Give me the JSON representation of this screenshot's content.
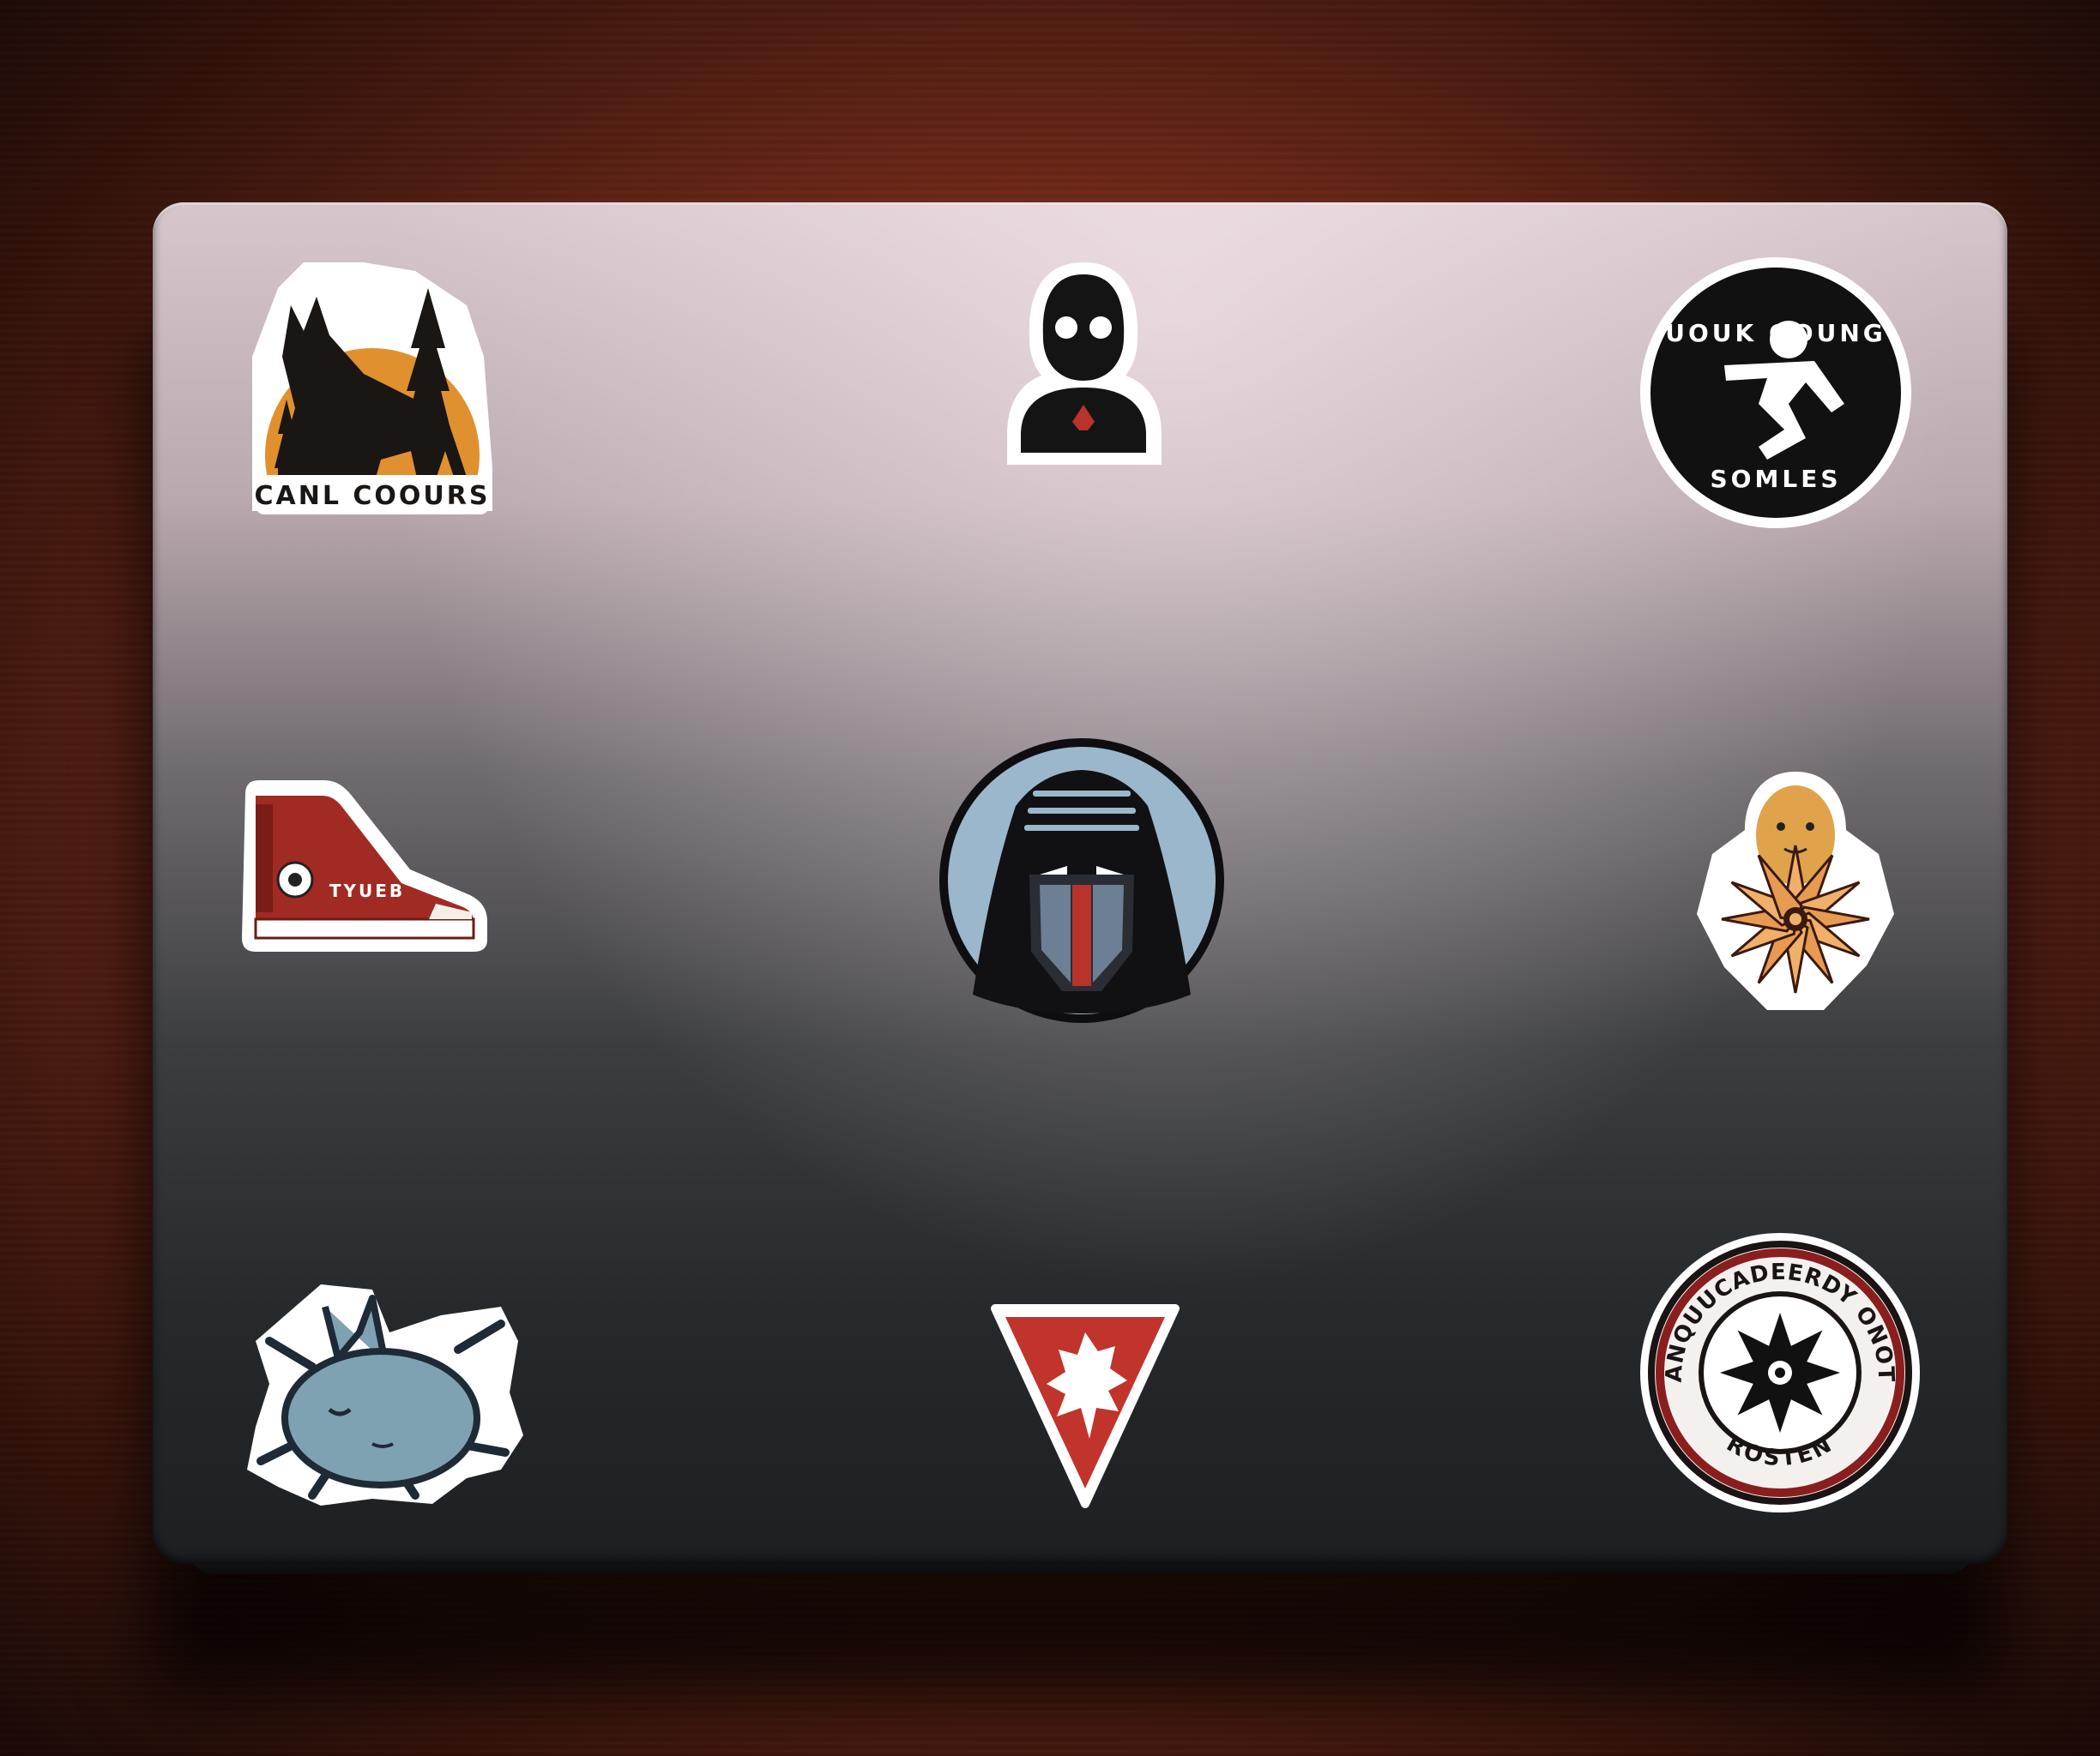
{
  "scene": "laptop-lid-with-stickers",
  "colors": {
    "desk": "#6a2616",
    "lid_top": "#d7c7cc",
    "lid_bottom": "#1d1f22",
    "sticker_border": "#ffffff",
    "orange": "#e0902e",
    "red": "#b8332a",
    "navy": "#1b1b1f",
    "light_blue": "#9bb7cb"
  },
  "stickers": {
    "wolf": {
      "icon": "wolf-forest-icon",
      "caption": "CANL COOURS"
    },
    "figure": {
      "icon": "silhouette-person-icon"
    },
    "runner": {
      "icon": "running-figure-icon",
      "top_text": "UOUK OOUNG",
      "bottom_text": "SOMLES"
    },
    "sneaker": {
      "icon": "high-top-sneaker-icon",
      "side_text": "TYUEB"
    },
    "helmet": {
      "icon": "dark-helmet-icon"
    },
    "flower_face": {
      "icon": "flower-face-icon"
    },
    "creature": {
      "icon": "blue-creature-icon"
    },
    "triangle": {
      "icon": "red-triangle-icon"
    },
    "badge": {
      "icon": "flower-badge-icon",
      "ring_text": "ANQUUCADEERDY ONOT",
      "bottom_text": "ROSTEN"
    }
  }
}
